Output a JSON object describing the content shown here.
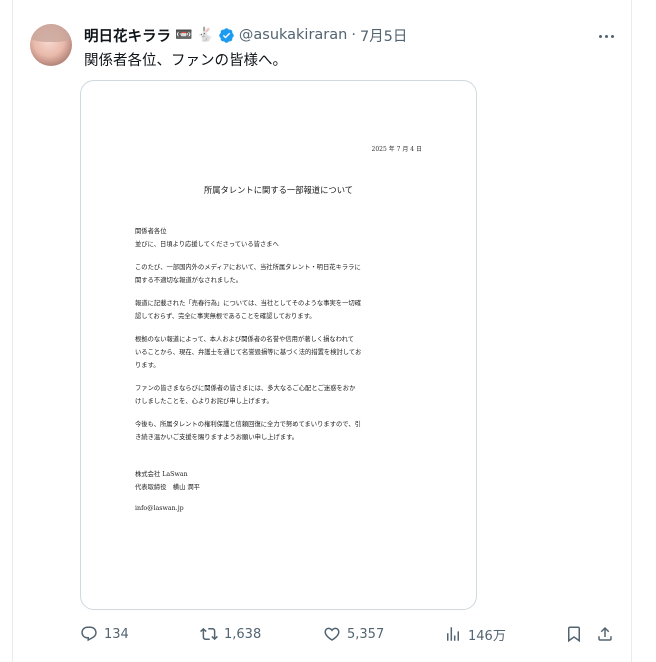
{
  "tweet": {
    "display_name": "明日花キララ",
    "emoji_1": "📼",
    "emoji_2": "🐇",
    "handle": "@asukakiraran",
    "separator": "·",
    "date": "7月5日",
    "text": "関係者各位、ファンの皆様へ。"
  },
  "document": {
    "date": "2025 年 7 月 4 日",
    "title": "所属タレントに関する一部報道について",
    "greeting": [
      "関係者各位",
      "並びに、日頃より応援してくださっている皆さまへ"
    ],
    "para1": [
      "このたび、一部国内外のメディアにおいて、当社所属タレント・明日花キララに",
      "関する不適切な報道がなされました。"
    ],
    "para2": [
      "報道に記載された「売春行為」については、当社としてそのような事実を一切確",
      "認しておらず、完全に事実無根であることを確認しております。"
    ],
    "para3": [
      "根拠のない報道によって、本人および関係者の名誉や信用が著しく損なわれて",
      "いることから、現在、弁護士を通じて名誉毀損等に基づく法的措置を検討してお",
      "ります。"
    ],
    "para4": [
      "ファンの皆さまならびに関係者の皆さまには、多大なるご心配とご迷惑をおか",
      "けしましたことを、心よりお詫び申し上げます。"
    ],
    "para5": [
      "今後も、所属タレントの権利保護と信頼回復に全力で努めてまいりますので、引",
      "き続き温かいご支援を賜りますようお願い申し上げます。"
    ],
    "company": "株式会社 LaSwan",
    "representative": "代表取締役　横山 潤平",
    "email": "info@laswan.jp"
  },
  "actions": {
    "replies": "134",
    "reposts": "1,638",
    "likes": "5,357",
    "views": "146万"
  },
  "colors": {
    "text": "#0f1419",
    "secondary": "#536471",
    "verified": "#1d9bf0",
    "border": "#cfd9de"
  },
  "icons": [
    "more-icon",
    "verified-badge-icon",
    "reply-icon",
    "repost-icon",
    "like-icon",
    "views-icon",
    "bookmark-icon",
    "share-icon"
  ]
}
